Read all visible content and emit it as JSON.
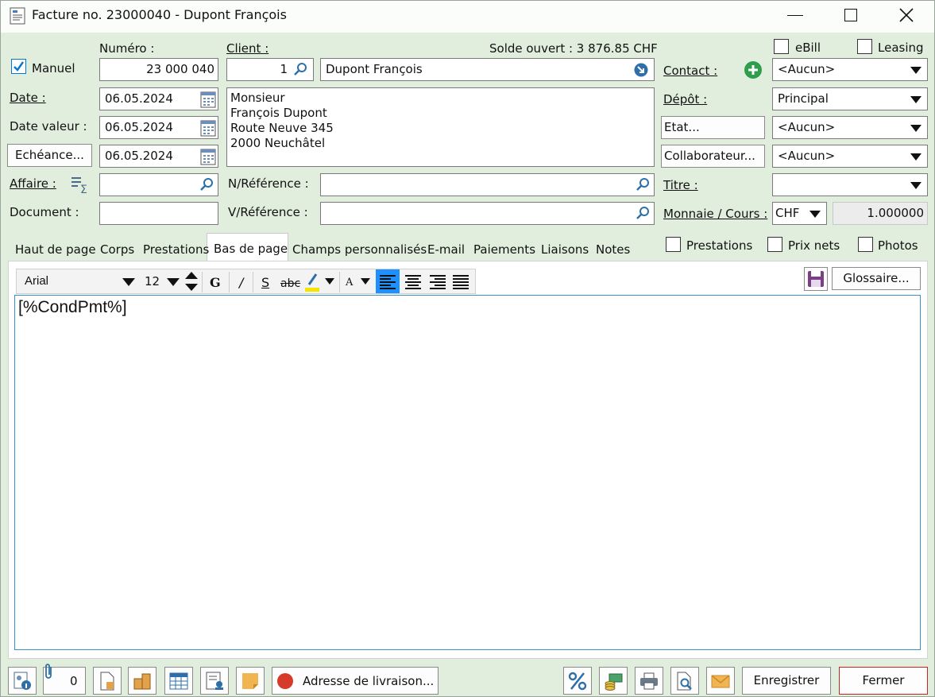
{
  "window": {
    "title": "Facture no. 23000040 - Dupont François"
  },
  "header": {
    "numero_label": "Numéro :",
    "client_label": "Client :",
    "solde_ouvert": "Solde ouvert : 3 876.85 CHF",
    "manuel_label": "Manuel",
    "manuel_checked": true,
    "numero_value": "23 000 040",
    "client_number": "1",
    "client_name": "Dupont François",
    "date_label": "Date :",
    "date_value": "06.05.2024",
    "date_valeur_label": "Date valeur :",
    "date_valeur_value": "06.05.2024",
    "echeance_button": "Echéance...",
    "echeance_value": "06.05.2024",
    "affaire_label": "Affaire :",
    "affaire_value": "",
    "document_label": "Document :",
    "document_value": "",
    "address_lines": [
      "Monsieur",
      "François Dupont",
      "Route Neuve 345",
      "2000 Neuchâtel"
    ],
    "nref_label": "N/Référence :",
    "nref_value": "",
    "vref_label": "V/Référence :",
    "vref_value": ""
  },
  "right_panel": {
    "ebill_label": "eBill",
    "leasing_label": "Leasing",
    "contact_label": "Contact :",
    "contact_value": "<Aucun>",
    "depot_label": "Dépôt :",
    "depot_value": "Principal",
    "etat_button": "Etat...",
    "etat_value": "<Aucun>",
    "collaborateur_button": "Collaborateur...",
    "collaborateur_value": "<Aucun>",
    "titre_label": "Titre :",
    "titre_value": "",
    "monnaie_label": "Monnaie / Cours :",
    "monnaie_value": "CHF",
    "cours_value": "1.000000",
    "prestations_label": "Prestations",
    "prix_nets_label": "Prix nets",
    "photos_label": "Photos"
  },
  "tabs": [
    {
      "label": "Haut de page",
      "active": false
    },
    {
      "label": "Corps",
      "active": false
    },
    {
      "label": "Prestations",
      "active": false
    },
    {
      "label": "Bas de page",
      "active": true
    },
    {
      "label": "Champs personnalisés",
      "active": false
    },
    {
      "label": "E-mail",
      "active": false
    },
    {
      "label": "Paiements",
      "active": false
    },
    {
      "label": "Liaisons",
      "active": false
    },
    {
      "label": "Notes",
      "active": false
    }
  ],
  "editor": {
    "font": "Arial",
    "size": "12",
    "bold": "G",
    "italic": "/",
    "underline": "S",
    "strike": "abc",
    "font_color": "A",
    "glossaire_button": "Glossaire...",
    "content": "[%CondPmt%]"
  },
  "footer": {
    "attachments_count": "0",
    "adresse_button": "Adresse de livraison...",
    "enregistrer_button": "Enregistrer",
    "fermer_button": "Fermer"
  },
  "colors": {
    "background": "#e1eedd",
    "accent": "#0078d4",
    "highlight": "#f5e400",
    "close_border": "#cc2222",
    "record_red": "#d63a2a",
    "add_green": "#2e9e4c"
  }
}
